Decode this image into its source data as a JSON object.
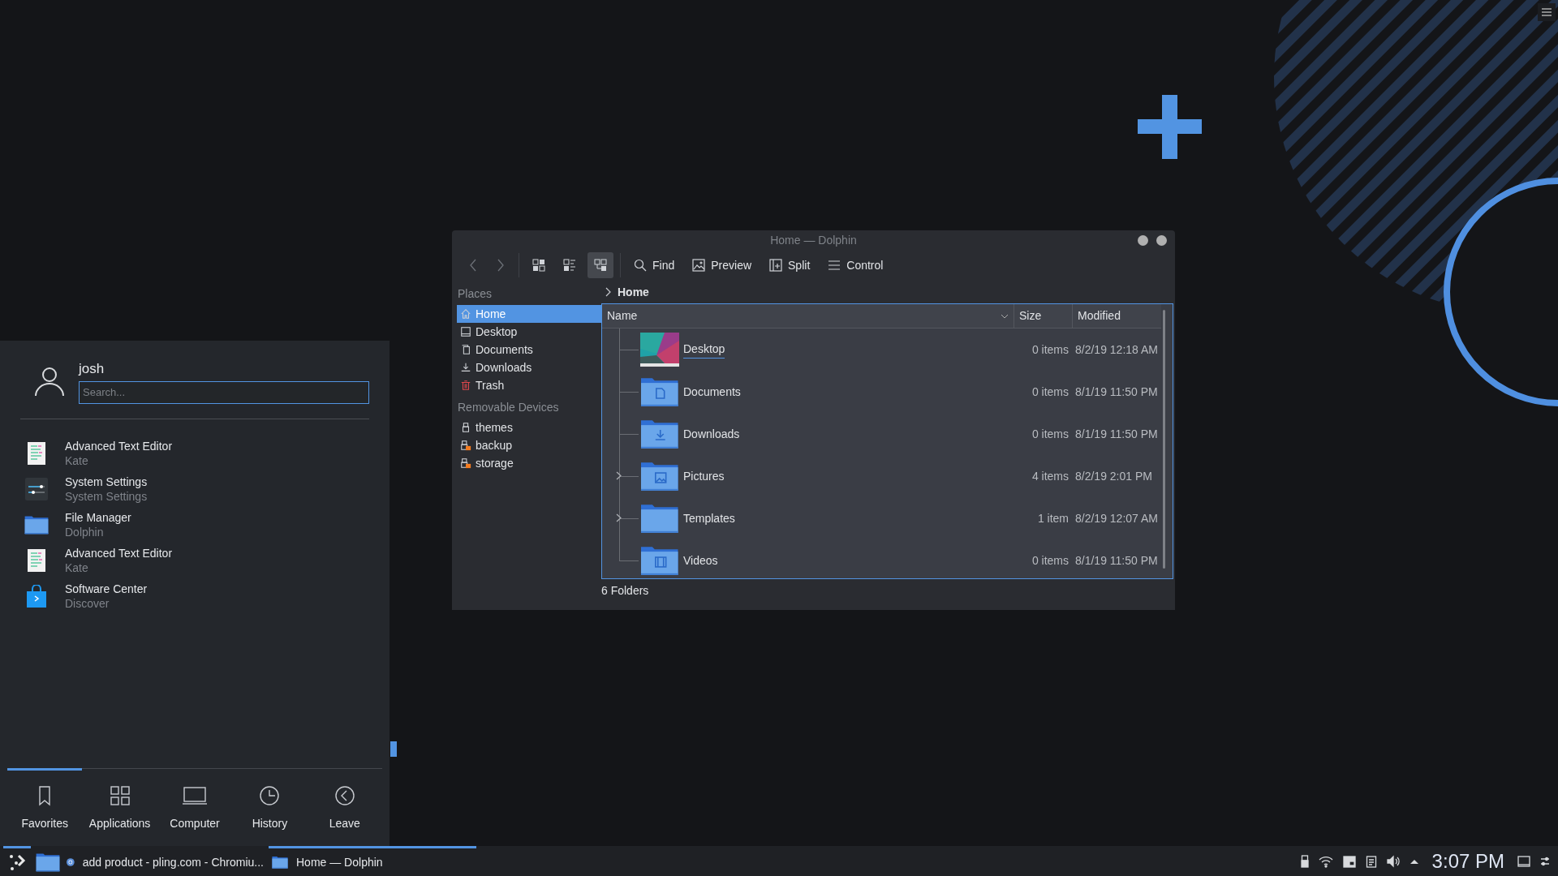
{
  "dolphin": {
    "title": "Home — Dolphin",
    "view_modes": [
      {
        "kind": "icons",
        "selected": false
      },
      {
        "kind": "compact",
        "selected": false
      },
      {
        "kind": "details",
        "selected": true
      }
    ],
    "actions": [
      {
        "kind": "find",
        "label": "Find"
      },
      {
        "kind": "preview",
        "label": "Preview"
      },
      {
        "kind": "split",
        "label": "Split"
      },
      {
        "kind": "control",
        "label": "Control"
      }
    ],
    "places": [
      {
        "heading": "Places",
        "items": [
          {
            "label": "Home",
            "kind": "home",
            "selected": true
          },
          {
            "label": "Desktop",
            "kind": "desktop",
            "selected": false
          },
          {
            "label": "Documents",
            "kind": "documents",
            "selected": false
          },
          {
            "label": "Downloads",
            "kind": "downloads",
            "selected": false
          },
          {
            "label": "Trash",
            "kind": "trash",
            "selected": false
          }
        ]
      },
      {
        "heading": "Removable Devices",
        "items": [
          {
            "label": "themes",
            "kind": "usb",
            "selected": false
          },
          {
            "label": "backup",
            "kind": "usb-warn",
            "selected": false
          },
          {
            "label": "storage",
            "kind": "usb-warn",
            "selected": false
          }
        ]
      }
    ],
    "breadcrumb": "Home",
    "columns": [
      "Name",
      "Size",
      "Modified"
    ],
    "rows": [
      {
        "name": "Desktop",
        "kind": "desktop",
        "size": "0 items",
        "modified": "8/2/19 12:18 AM",
        "expandable": false,
        "hovered": true
      },
      {
        "name": "Documents",
        "kind": "documents",
        "size": "0 items",
        "modified": "8/1/19 11:50 PM",
        "expandable": false,
        "hovered": false
      },
      {
        "name": "Downloads",
        "kind": "downloads",
        "size": "0 items",
        "modified": "8/1/19 11:50 PM",
        "expandable": false,
        "hovered": false
      },
      {
        "name": "Pictures",
        "kind": "pictures",
        "size": "4 items",
        "modified": "8/2/19 2:01 PM",
        "expandable": true,
        "hovered": false
      },
      {
        "name": "Templates",
        "kind": "plain",
        "size": "1 item",
        "modified": "8/2/19 12:07 AM",
        "expandable": true,
        "hovered": false
      },
      {
        "name": "Videos",
        "kind": "videos",
        "size": "0 items",
        "modified": "8/1/19 11:50 PM",
        "expandable": false,
        "hovered": false
      }
    ],
    "status": "6 Folders"
  },
  "launcher": {
    "user": "josh",
    "search": {
      "placeholder": "Search..."
    },
    "apps": [
      {
        "name": "Advanced Text Editor",
        "generic": "Kate",
        "kind": "editor"
      },
      {
        "name": "System Settings",
        "generic": "System Settings",
        "kind": "settings"
      },
      {
        "name": "File Manager",
        "generic": "Dolphin",
        "kind": "files"
      },
      {
        "name": "Advanced Text Editor",
        "generic": "Kate",
        "kind": "editor"
      },
      {
        "name": "Software Center",
        "generic": "Discover",
        "kind": "store"
      }
    ],
    "tabs": [
      {
        "label": "Favorites",
        "kind": "favorites",
        "selected": true
      },
      {
        "label": "Applications",
        "kind": "applications",
        "selected": false
      },
      {
        "label": "Computer",
        "kind": "computer",
        "selected": false
      },
      {
        "label": "History",
        "kind": "history",
        "selected": false
      },
      {
        "label": "Leave",
        "kind": "leave",
        "selected": false
      }
    ]
  },
  "taskbar": {
    "tasks": [
      {
        "kind": "launcher",
        "selected": true
      },
      {
        "kind": "pinned-files",
        "selected": false
      },
      {
        "kind": "browser",
        "label": "add product - pling.com - Chromiu...",
        "selected": false
      },
      {
        "kind": "files",
        "label": "Home — Dolphin",
        "selected": true
      }
    ],
    "clock": "3:07 PM"
  }
}
